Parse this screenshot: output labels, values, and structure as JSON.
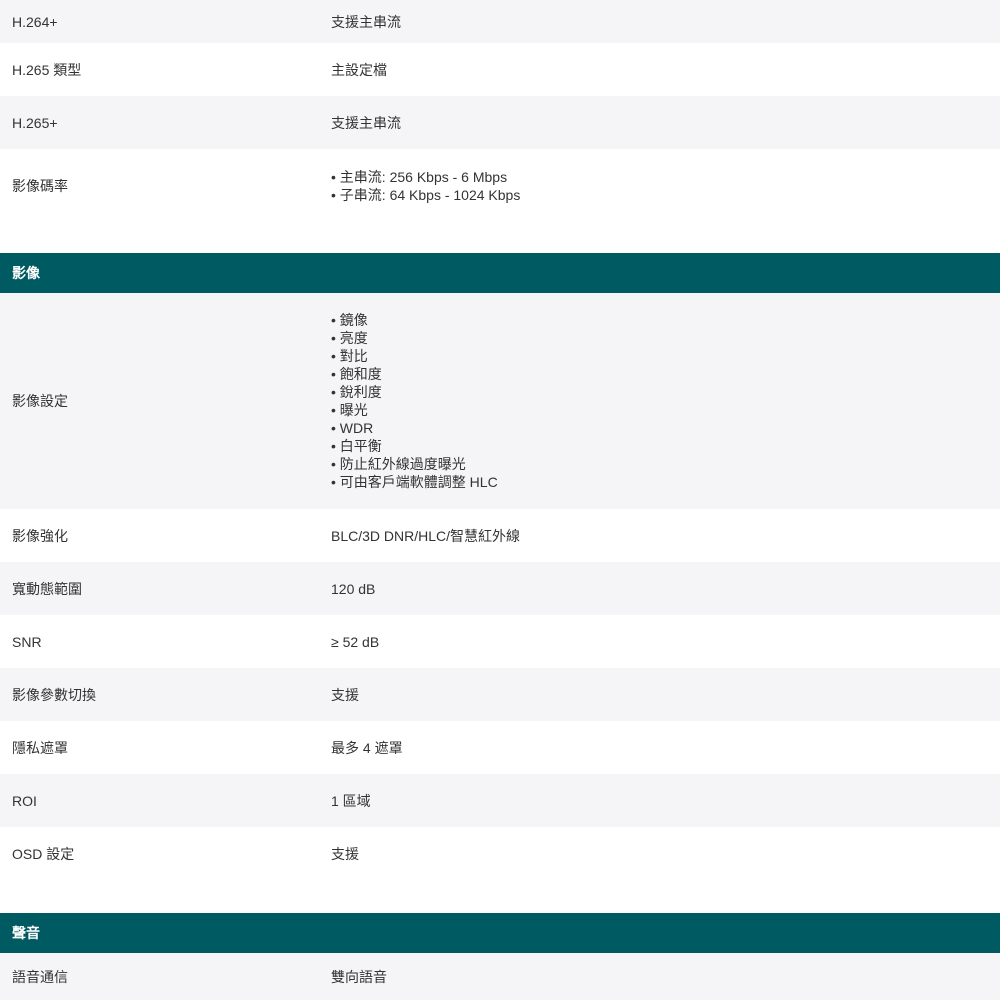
{
  "rows_top": [
    {
      "label": "H.264+",
      "value": "支援主串流"
    },
    {
      "label": "H.265 類型",
      "value": "主設定檔"
    },
    {
      "label": "H.265+",
      "value": "支援主串流"
    }
  ],
  "bitrate": {
    "label": "影像碼率",
    "items": [
      "主串流: 256 Kbps - 6 Mbps",
      "子串流: 64 Kbps - 1024 Kbps"
    ]
  },
  "section_image": {
    "title": "影像"
  },
  "image_settings": {
    "label": "影像設定",
    "items": [
      "鏡像",
      "亮度",
      "對比",
      "飽和度",
      "銳利度",
      "曝光",
      "WDR",
      "白平衡",
      "防止紅外線過度曝光",
      "可由客戶端軟體調整 HLC"
    ]
  },
  "rows_image": [
    {
      "label": "影像強化",
      "value": "BLC/3D DNR/HLC/智慧紅外線"
    },
    {
      "label": "寬動態範圍",
      "value": "120 dB"
    },
    {
      "label": "SNR",
      "value": "≥ 52 dB"
    },
    {
      "label": "影像參數切換",
      "value": "支援"
    },
    {
      "label": "隱私遮罩",
      "value": "最多 4 遮罩"
    },
    {
      "label": "ROI",
      "value": "1 區域"
    },
    {
      "label": "OSD 設定",
      "value": "支援"
    }
  ],
  "section_audio": {
    "title": "聲音"
  },
  "rows_audio": [
    {
      "label": "語音通信",
      "value": "雙向語音"
    }
  ]
}
